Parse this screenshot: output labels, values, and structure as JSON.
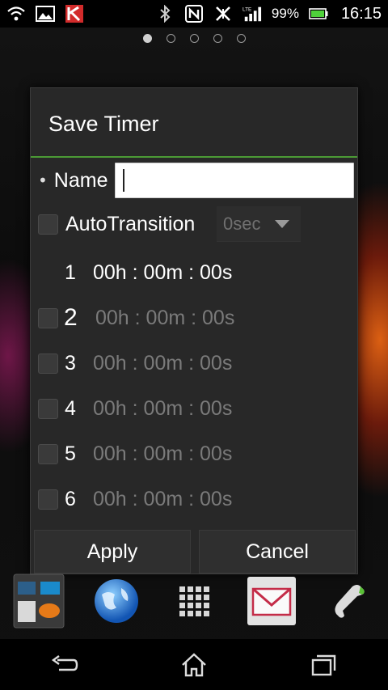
{
  "status_bar": {
    "battery_percent": "99%",
    "time": "16:15",
    "icons": [
      "wifi-question-icon",
      "image-notification-icon",
      "kaspersky-icon",
      "bluetooth-icon",
      "nfc-icon",
      "signal-blocked-icon",
      "lte-signal-icon",
      "battery-icon"
    ]
  },
  "home_pages": {
    "count": 5,
    "active_index": 0
  },
  "dialog": {
    "title": "Save Timer",
    "name_label": "Name",
    "name_value": "",
    "auto_transition_label": "AutoTransition",
    "auto_transition_value": "0sec",
    "auto_transition_checked": false,
    "timers": [
      {
        "number": "1",
        "time": "00h : 00m : 00s",
        "active": true
      },
      {
        "number": "2",
        "time": "00h : 00m : 00s",
        "active": false
      },
      {
        "number": "3",
        "time": "00h : 00m : 00s",
        "active": false
      },
      {
        "number": "4",
        "time": "00h : 00m : 00s",
        "active": false
      },
      {
        "number": "5",
        "time": "00h : 00m : 00s",
        "active": false
      },
      {
        "number": "6",
        "time": "00h : 00m : 00s",
        "active": false
      }
    ],
    "apply_label": "Apply",
    "cancel_label": "Cancel"
  },
  "dock": [
    "widgets-folder-icon",
    "browser-globe-icon",
    "app-drawer-icon",
    "email-icon",
    "phone-icon"
  ],
  "nav_bar": [
    "back-icon",
    "home-icon",
    "recent-apps-icon"
  ],
  "colors": {
    "accent": "#4b9a35",
    "dialog_bg": "#282828",
    "disabled_text": "#7a7a7a"
  }
}
